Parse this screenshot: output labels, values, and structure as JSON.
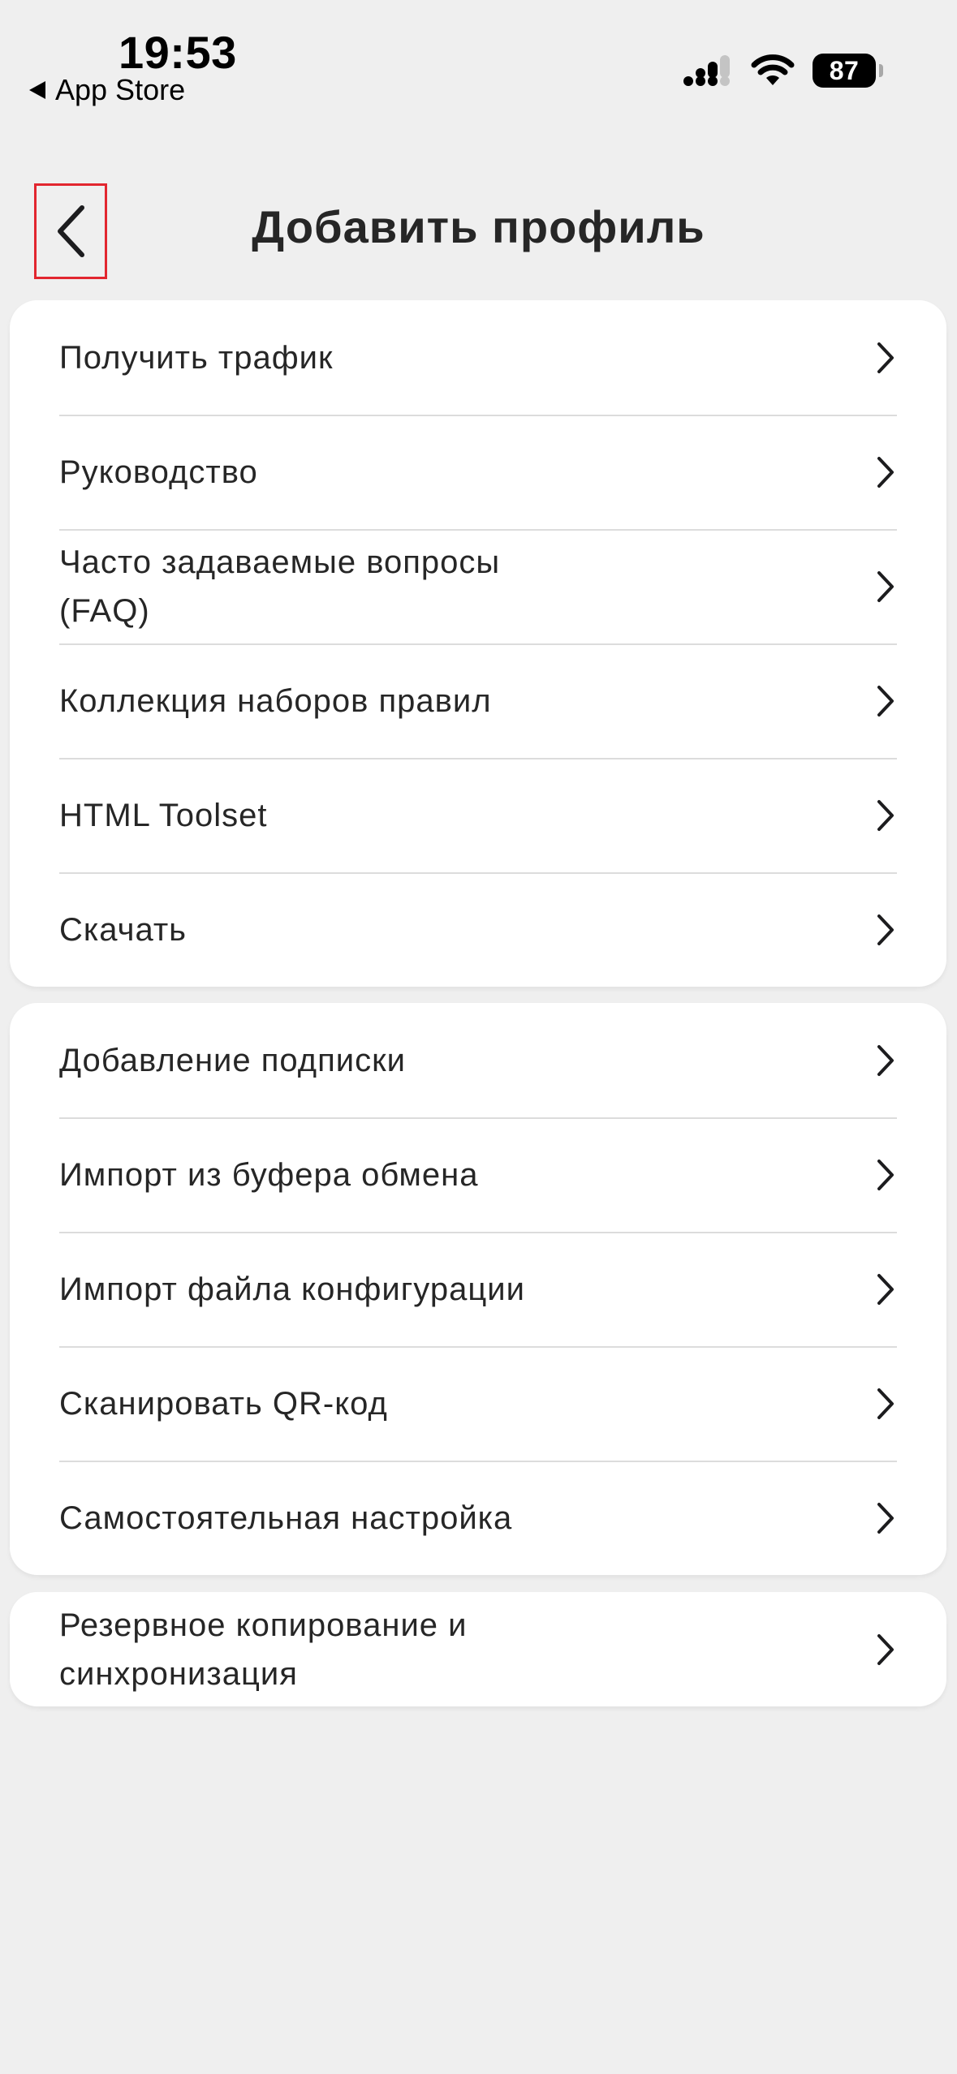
{
  "status_bar": {
    "time": "19:53",
    "back_app": "App Store",
    "battery": "87"
  },
  "header": {
    "title": "Добавить профиль",
    "back_icon": "chevron-left-icon"
  },
  "groups": [
    {
      "items": [
        {
          "label": "Получить трафик"
        },
        {
          "label": "Руководство"
        },
        {
          "label": "Часто задаваемые вопросы\n(FAQ)"
        },
        {
          "label": "Коллекция наборов правил"
        },
        {
          "label": "HTML Toolset"
        },
        {
          "label": "Скачать"
        }
      ]
    },
    {
      "items": [
        {
          "label": "Добавление подписки"
        },
        {
          "label": "Импорт из буфера обмена"
        },
        {
          "label": "Импорт файла конфигурации"
        },
        {
          "label": "Сканировать QR-код"
        },
        {
          "label": "Самостоятельная настройка"
        }
      ]
    },
    {
      "items": [
        {
          "label": "Резервное копирование и\nсинхронизация"
        }
      ]
    }
  ],
  "colors": {
    "background": "#efefef",
    "card": "#ffffff",
    "separator": "#dcdcdc",
    "highlight_border": "#e2262f",
    "text": "#262626"
  }
}
